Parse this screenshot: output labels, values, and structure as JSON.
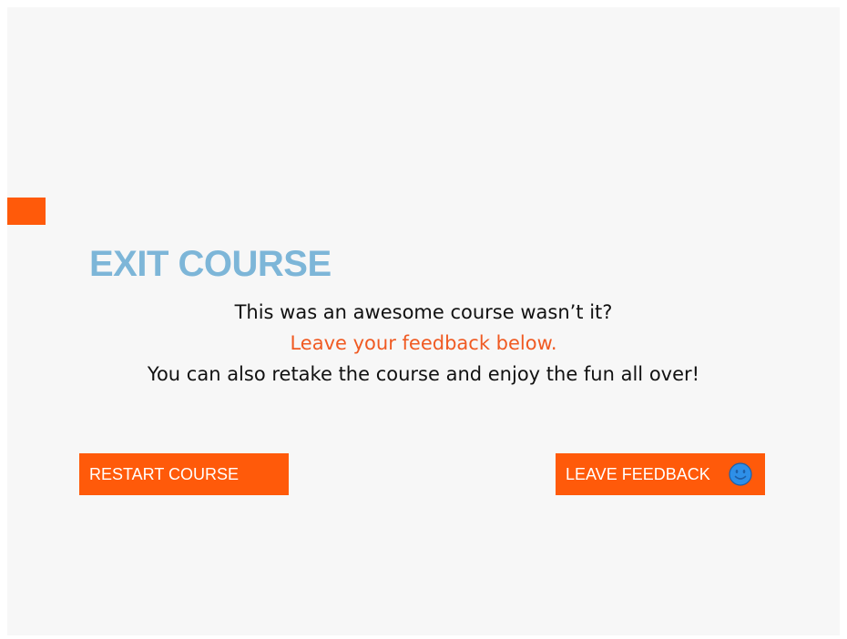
{
  "exit_screen": {
    "title": "EXIT COURSE",
    "message_line1": "This was an awesome course wasn’t it?",
    "message_line2": "Leave your feedback below.",
    "message_line3": "You can also retake the course and enjoy the fun all over!"
  },
  "buttons": {
    "restart_label": "RESTART COURSE",
    "feedback_label": "LEAVE FEEDBACK",
    "feedback_icon": "smiley-icon"
  },
  "colors": {
    "accent": "#ff5a0a",
    "title": "#7db6d8",
    "highlight_text": "#f05a22",
    "smiley_fill": "#2e8fe8",
    "smiley_stroke": "#1d5fa8"
  }
}
